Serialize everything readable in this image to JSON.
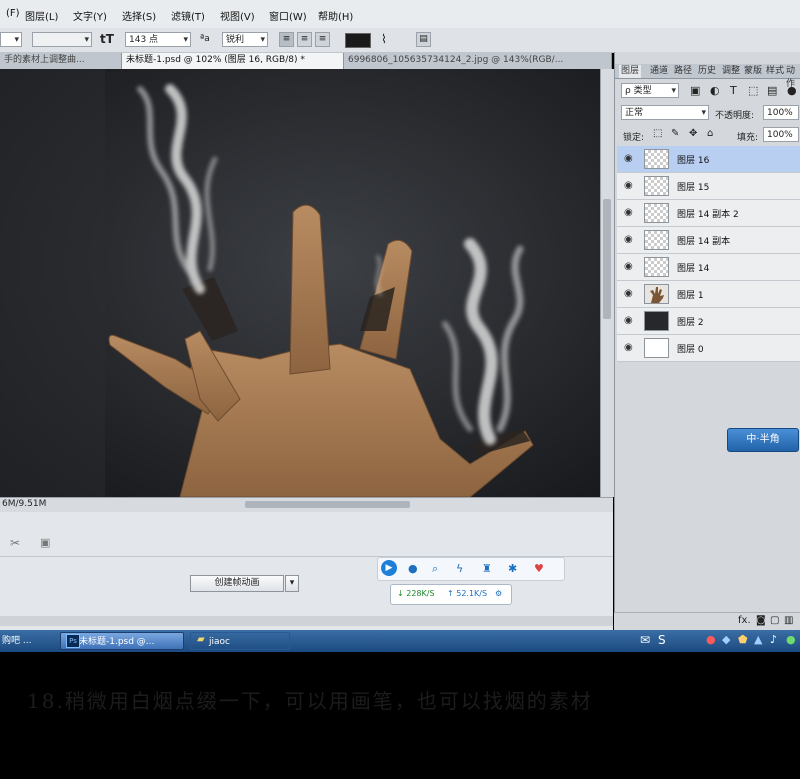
{
  "menu": [
    "(F)",
    "图层(L)",
    "文字(Y)",
    "选择(S)",
    "滤镜(T)",
    "视图(V)",
    "窗口(W)",
    "帮助(H)"
  ],
  "options": {
    "font_size": "143 点",
    "aa_label": "ªa",
    "aa_mode": "锐利"
  },
  "tabs": [
    {
      "label": "手的素材上调整曲...",
      "active": false
    },
    {
      "label": "未标题-1.psd @ 102% (图层 16, RGB/8) *",
      "active": true
    },
    {
      "label": "6996806_105635734124_2.jpg @ 143%(RGB/...",
      "active": false
    }
  ],
  "status": {
    "doc_size": "6M/9.51M"
  },
  "animation": {
    "create_button": "创建帧动画"
  },
  "speed_widget": {
    "down": "↓ 228K/S",
    "up": "↑ 52.1K/S"
  },
  "panel": {
    "tabs": [
      "图层",
      "通道",
      "路径",
      "历史",
      "调整",
      "蒙版",
      "样式",
      "动作"
    ],
    "kind_filter": "ρ 类型",
    "blend_mode": "正常",
    "opacity_label": "不透明度:",
    "opacity_value": "100%",
    "lock_label": "锁定:",
    "fill_label": "填充:",
    "fill_value": "100%",
    "layers": [
      {
        "name": "图层 16",
        "selected": true,
        "thumb": "transparent"
      },
      {
        "name": "图层 15",
        "selected": false,
        "thumb": "transparent"
      },
      {
        "name": "图层 14 副本 2",
        "selected": false,
        "thumb": "transparent"
      },
      {
        "name": "图层 14 副本",
        "selected": false,
        "thumb": "transparent"
      },
      {
        "name": "图层 14",
        "selected": false,
        "thumb": "transparent"
      },
      {
        "name": "图层 1",
        "selected": false,
        "thumb": "hand"
      },
      {
        "name": "图层 2",
        "selected": false,
        "thumb": "dark"
      },
      {
        "name": "图层 0",
        "selected": false,
        "thumb": "white"
      }
    ],
    "footer": "fx."
  },
  "ime_label": "中·半角",
  "taskbar": {
    "left_item": "购吧 ...",
    "ps_item": "未标题-1.psd @...",
    "folder_item": "jiaoc"
  },
  "caption": "18.稍微用白烟点缀一下，可以用画笔，也可以找烟的素材",
  "colors": {
    "selected_layer": "#b8cff2",
    "taskbar": "#1c4a80",
    "canvas_bg": "#2a2c30"
  }
}
